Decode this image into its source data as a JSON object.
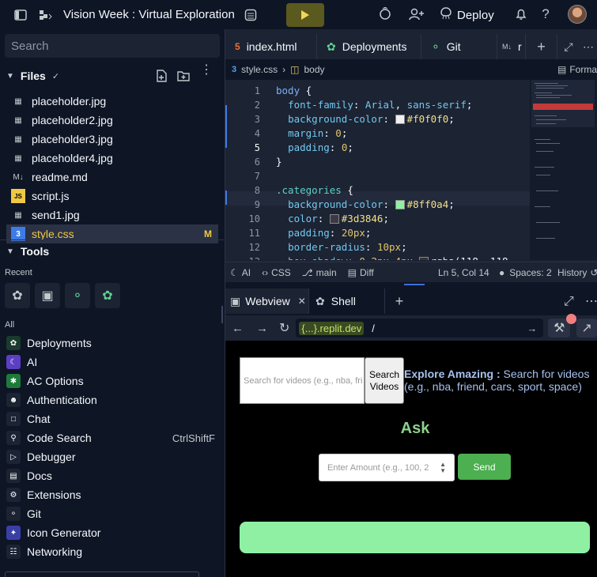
{
  "topbar": {
    "title": "Vision Week : Virtual Exploration",
    "deploy_label": "Deploy"
  },
  "left": {
    "search_placeholder": "Search",
    "files_header": "Files",
    "files": [
      {
        "name": "placeholder.jpg",
        "icon": "image-icon"
      },
      {
        "name": "placeholder2.jpg",
        "icon": "image-icon"
      },
      {
        "name": "placeholder3.jpg",
        "icon": "image-icon"
      },
      {
        "name": "placeholder4.jpg",
        "icon": "image-icon"
      },
      {
        "name": "readme.md",
        "icon": "markdown-icon"
      },
      {
        "name": "script.js",
        "icon": "js-icon"
      },
      {
        "name": "send1.jpg",
        "icon": "image-icon"
      },
      {
        "name": "style.css",
        "icon": "css-icon",
        "status": "M"
      }
    ],
    "tools_header": "Tools",
    "recent_label": "Recent",
    "all_label": "All",
    "tools": [
      {
        "name": "Deployments",
        "color": "#1a3b2e"
      },
      {
        "name": "AI",
        "color": "#5b3fc4"
      },
      {
        "name": "AC Options",
        "color": "#1e7a3a"
      },
      {
        "name": "Authentication",
        "color": "#1c2333"
      },
      {
        "name": "Chat",
        "color": "#1c2333"
      },
      {
        "name": "Code Search",
        "color": "#1c2333",
        "shortcut": "CtrlShiftF"
      },
      {
        "name": "Debugger",
        "color": "#1c2333"
      },
      {
        "name": "Docs",
        "color": "#1c2333"
      },
      {
        "name": "Extensions",
        "color": "#1c2333"
      },
      {
        "name": "Git",
        "color": "#1c2333"
      },
      {
        "name": "Icon Generator",
        "color": "#3a3fa8"
      },
      {
        "name": "Networking",
        "color": "#1c2333"
      }
    ]
  },
  "editor": {
    "tabs": [
      {
        "label": "index.html"
      },
      {
        "label": "Deployments"
      },
      {
        "label": "Git"
      },
      {
        "label": "r"
      }
    ],
    "breadcrumb": {
      "file": "style.css",
      "selector": "body",
      "format": "Forma"
    },
    "status": {
      "ai": "AI",
      "lang": "CSS",
      "branch": "main",
      "diff": "Diff",
      "position": "Ln 5, Col 14",
      "spaces": "Spaces: 2",
      "history": "History"
    }
  },
  "webview": {
    "tabs": [
      {
        "label": "Webview"
      },
      {
        "label": "Shell"
      }
    ],
    "url_prefix": "{...}.replit.dev",
    "url_path": "/",
    "preview": {
      "search_placeholder": "Search for videos (e.g., nba, fri",
      "search_button": "Search Videos",
      "explore_bold": "Explore Amazing :",
      "explore_text": " Search for videos (e.g., nba, friend, cars, sport, space)",
      "ask_title": "Ask",
      "amount_placeholder": "Enter Amount (e.g., 100, 2",
      "send_label": "Send"
    }
  }
}
